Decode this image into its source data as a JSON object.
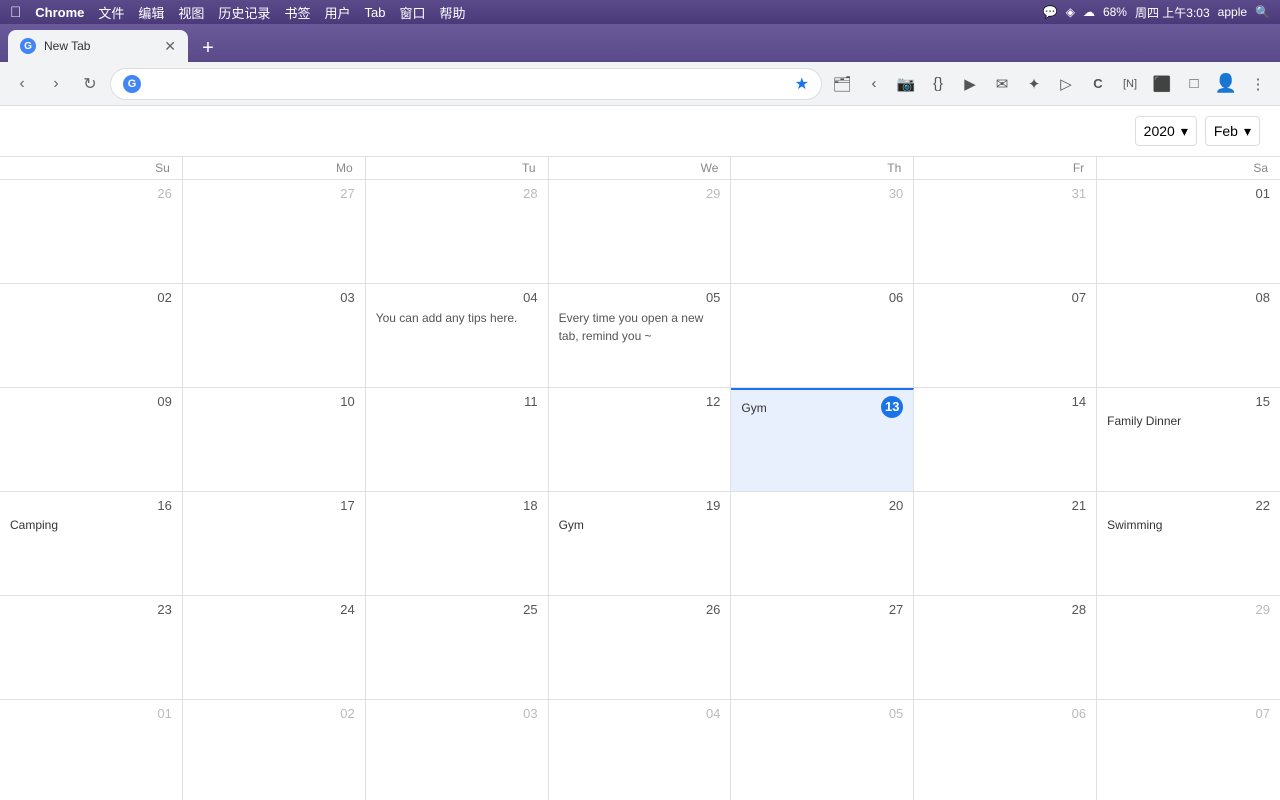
{
  "menubar": {
    "apple": "&#63743;",
    "chrome": "Chrome",
    "items": [
      "文件",
      "编辑",
      "视图",
      "历史记录",
      "书签",
      "用户",
      "Tab",
      "窗口",
      "帮助"
    ],
    "right": {
      "time": "周四 上午3:03",
      "battery": "68%",
      "user": "apple"
    }
  },
  "tab": {
    "title": "New Tab",
    "add_label": "+"
  },
  "navbar": {
    "address": "",
    "address_placeholder": ""
  },
  "calendar": {
    "year": "2020",
    "month": "Feb",
    "year_label": "2020",
    "month_label": "Feb",
    "year_arrow": "▾",
    "month_arrow": "▾",
    "day_headers": [
      "Su",
      "Mo",
      "Tu",
      "We",
      "Th",
      "Fr",
      "Sa"
    ],
    "weeks": [
      [
        {
          "date": "26",
          "other": true,
          "events": []
        },
        {
          "date": "27",
          "other": true,
          "events": []
        },
        {
          "date": "28",
          "other": true,
          "events": []
        },
        {
          "date": "29",
          "other": true,
          "events": []
        },
        {
          "date": "30",
          "other": true,
          "events": []
        },
        {
          "date": "31",
          "other": true,
          "events": []
        },
        {
          "date": "01",
          "events": []
        }
      ],
      [
        {
          "date": "02",
          "events": []
        },
        {
          "date": "03",
          "events": []
        },
        {
          "date": "04",
          "events": [],
          "tip": "You can add any tips here."
        },
        {
          "date": "05",
          "events": [],
          "tip": "Every time you open a new tab, remind you ~"
        },
        {
          "date": "06",
          "events": []
        },
        {
          "date": "07",
          "events": []
        },
        {
          "date": "08",
          "events": []
        }
      ],
      [
        {
          "date": "09",
          "events": []
        },
        {
          "date": "10",
          "events": []
        },
        {
          "date": "11",
          "events": []
        },
        {
          "date": "12",
          "events": []
        },
        {
          "date": "13",
          "today": true,
          "events": [
            "Gym"
          ]
        },
        {
          "date": "14",
          "events": []
        },
        {
          "date": "15",
          "events": [
            "Family Dinner"
          ]
        }
      ],
      [
        {
          "date": "16",
          "events": [
            "Camping"
          ]
        },
        {
          "date": "17",
          "events": []
        },
        {
          "date": "18",
          "events": []
        },
        {
          "date": "19",
          "events": [
            "Gym"
          ]
        },
        {
          "date": "20",
          "events": []
        },
        {
          "date": "21",
          "events": []
        },
        {
          "date": "22",
          "events": [
            "Swimming"
          ]
        }
      ],
      [
        {
          "date": "23",
          "events": []
        },
        {
          "date": "24",
          "events": []
        },
        {
          "date": "25",
          "events": []
        },
        {
          "date": "26",
          "events": []
        },
        {
          "date": "27",
          "events": []
        },
        {
          "date": "28",
          "events": []
        },
        {
          "date": "29",
          "other": true,
          "events": []
        }
      ],
      [
        {
          "date": "01",
          "other": true,
          "events": []
        },
        {
          "date": "02",
          "other": true,
          "events": []
        },
        {
          "date": "03",
          "other": true,
          "events": []
        },
        {
          "date": "04",
          "other": true,
          "events": []
        },
        {
          "date": "05",
          "other": true,
          "events": []
        },
        {
          "date": "06",
          "other": true,
          "events": []
        },
        {
          "date": "07",
          "other": true,
          "events": []
        }
      ]
    ]
  }
}
